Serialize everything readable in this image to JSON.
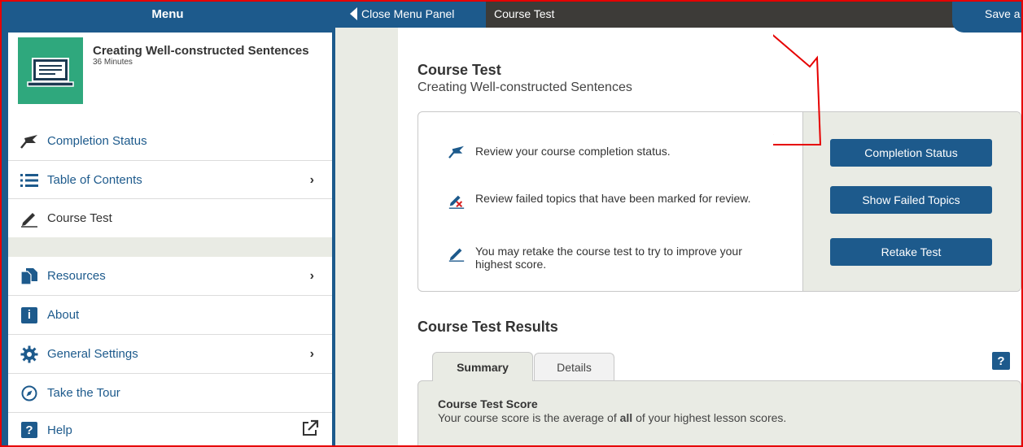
{
  "topbar": {
    "menu_label": "Menu",
    "close_panel_label": "Close Menu Panel",
    "page_title": "Course Test",
    "save_label": "Save a"
  },
  "sidebar": {
    "course": {
      "title": "Creating Well-constructed Sentences",
      "duration": "36 Minutes"
    },
    "items": [
      {
        "label": "Completion Status",
        "icon": "flag-icon",
        "chevron": false
      },
      {
        "label": "Table of Contents",
        "icon": "list-icon",
        "chevron": true
      },
      {
        "label": "Course Test",
        "icon": "pencil-icon",
        "chevron": false
      },
      {
        "label": "Resources",
        "icon": "documents-icon",
        "chevron": true
      },
      {
        "label": "About",
        "icon": "info-icon",
        "chevron": false
      },
      {
        "label": "General Settings",
        "icon": "gear-icon",
        "chevron": true
      },
      {
        "label": "Take the Tour",
        "icon": "compass-icon",
        "chevron": false
      },
      {
        "label": "Help",
        "icon": "help-icon",
        "chevron": false
      }
    ],
    "chevron": "›",
    "info_glyph": "i",
    "help_glyph": "?"
  },
  "main": {
    "title": "Course Test",
    "subtitle": "Creating Well-constructed Sentences",
    "rows": [
      {
        "text": "Review your course completion status.",
        "button": "Completion Status"
      },
      {
        "text": "Review failed topics that have been marked for review.",
        "button": "Show Failed Topics"
      },
      {
        "text": "You may retake the course test to try to improve your highest score.",
        "button": "Retake Test"
      }
    ],
    "results": {
      "title": "Course Test Results",
      "tabs": [
        "Summary",
        "Details"
      ],
      "help_glyph": "?",
      "score_title": "Course Test Score",
      "score_text_before": "Your course score is the average of ",
      "score_text_bold": "all",
      "score_text_after": " of your highest lesson scores."
    }
  },
  "colors": {
    "brand_blue": "#1d5a8c",
    "topbar_dark": "#3d3b38",
    "panel_gray": "#e9ebe4",
    "thumb_green": "#2fa87d",
    "annotation_red": "#e60000"
  }
}
